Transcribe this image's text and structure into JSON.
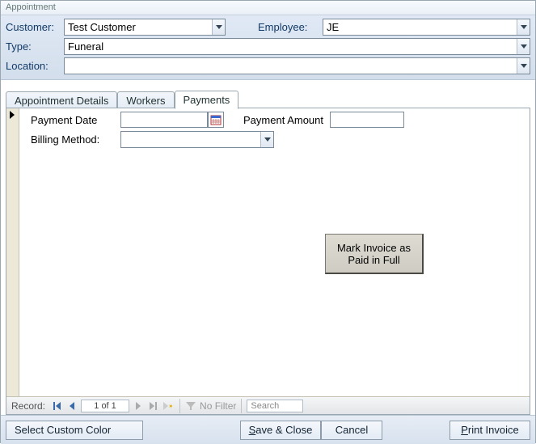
{
  "window": {
    "title": "Appointment"
  },
  "header": {
    "customer_label": "Customer:",
    "customer_value": "Test Customer",
    "employee_label": "Employee:",
    "employee_value": "JE",
    "type_label": "Type:",
    "type_value": "Funeral",
    "location_label": "Location:",
    "location_value": ""
  },
  "tabs": [
    {
      "label": "Appointment Details"
    },
    {
      "label": "Workers"
    },
    {
      "label": "Payments"
    }
  ],
  "payments": {
    "payment_date_label": "Payment Date",
    "payment_date_value": "",
    "payment_amount_label": "Payment Amount",
    "payment_amount_value": "",
    "billing_method_label": "Billing Method:",
    "billing_method_value": "",
    "mark_paid_button": "Mark Invoice as Paid in Full"
  },
  "recordnav": {
    "label": "Record:",
    "position": "1 of 1",
    "filter_label": "No Filter",
    "search_placeholder": "Search"
  },
  "footer": {
    "select_color": "Select Custom Color",
    "save_close": "Save & Close",
    "cancel": "Cancel",
    "print_invoice": "Print Invoice"
  }
}
